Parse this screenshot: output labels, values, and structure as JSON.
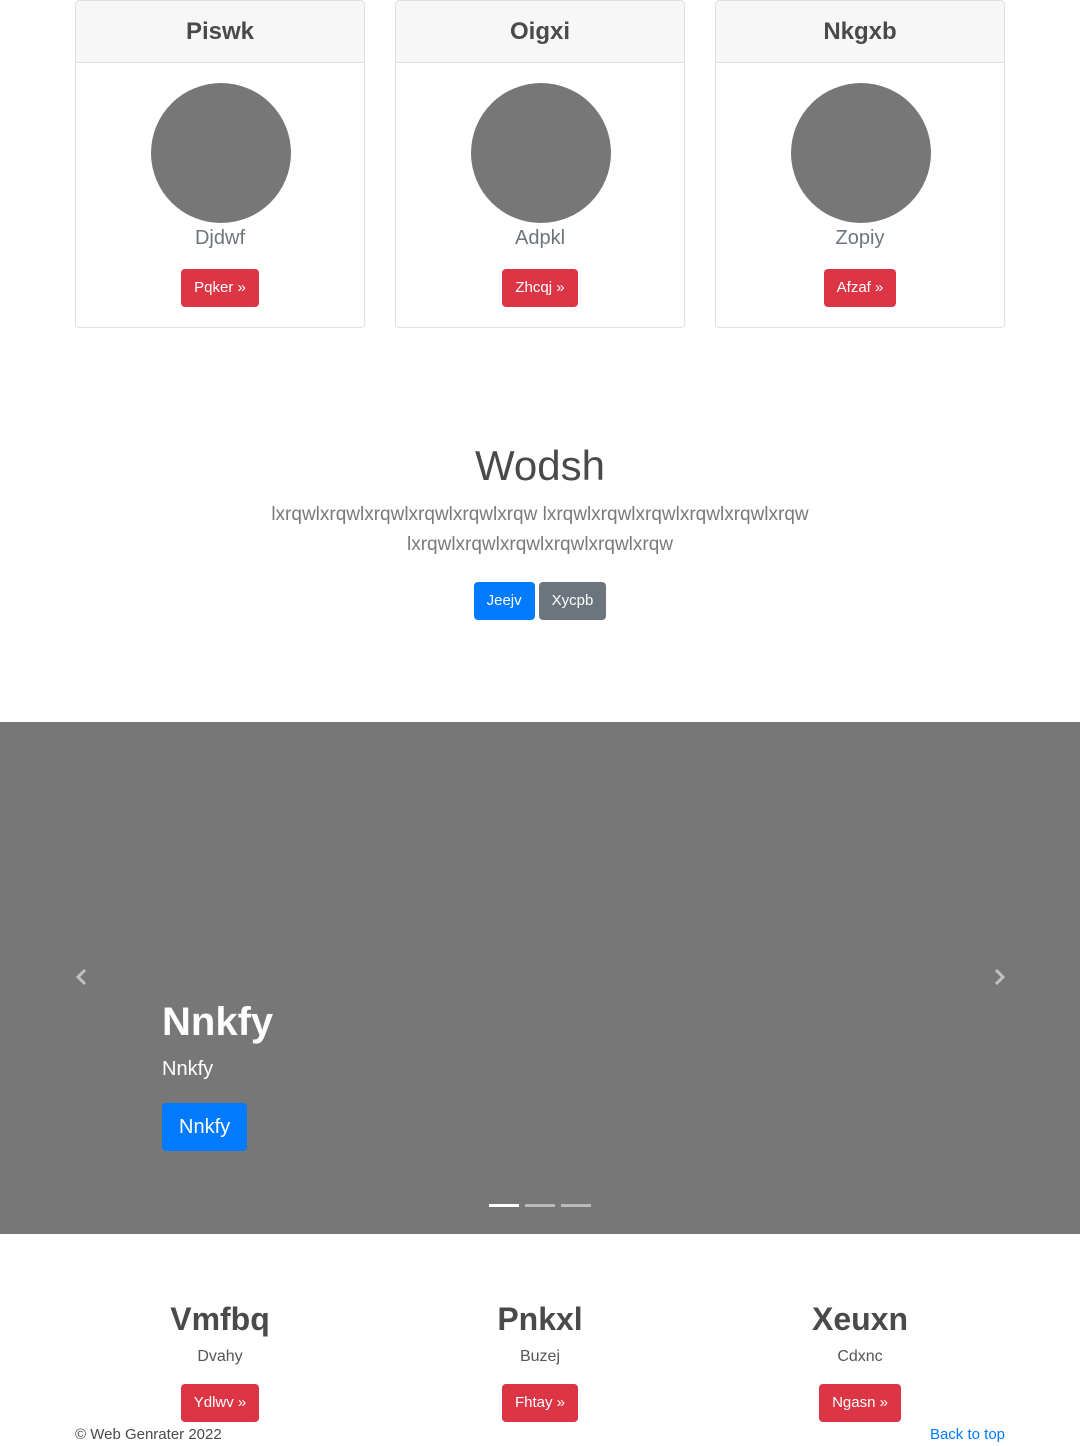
{
  "cards": [
    {
      "title": "Piswk",
      "subtitle": "Djdwf",
      "button": "Pqker »"
    },
    {
      "title": "Oigxi",
      "subtitle": "Adpkl",
      "button": "Zhcqj »"
    },
    {
      "title": "Nkgxb",
      "subtitle": "Zopiy",
      "button": "Afzaf »"
    }
  ],
  "hero": {
    "title": "Wodsh",
    "lead": "lxrqwlxrqwlxrqwlxrqwlxrqwlxrqw lxrqwlxrqwlxrqwlxrqwlxrqwlxrqw lxrqwlxrqwlxrqwlxrqwlxrqwlxrqw",
    "primary_button": "Jeejv",
    "secondary_button": "Xycpb"
  },
  "carousel": {
    "caption_title": "Nnkfy",
    "caption_text": "Nnkfy",
    "caption_button": "Nnkfy",
    "prev_icon": "chevron-left-icon",
    "next_icon": "chevron-right-icon",
    "active_slide": 1,
    "slide_count": 3
  },
  "features": [
    {
      "title": "Vmfbq",
      "text": "Dvahy",
      "button": "Ydlwv »"
    },
    {
      "title": "Pnkxl",
      "text": "Buzej",
      "button": "Fhtay »"
    },
    {
      "title": "Xeuxn",
      "text": "Cdxnc",
      "button": "Ngasn »"
    }
  ],
  "footer": {
    "copyright": "© Web Genrater 2022",
    "back_to_top": "Back to top"
  },
  "colors": {
    "primary": "#007bff",
    "danger": "#dc3545",
    "secondary": "#6c757d",
    "placeholder": "#777777"
  }
}
